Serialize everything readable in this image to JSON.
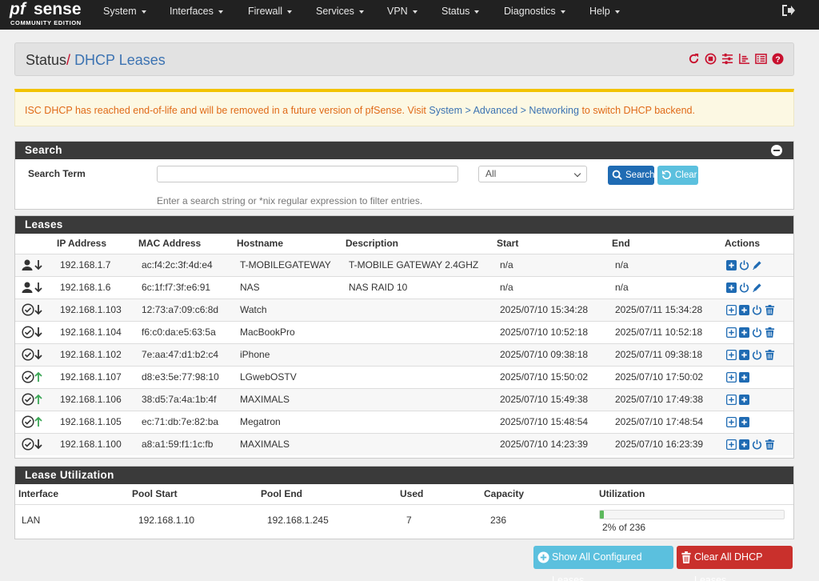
{
  "brand": {
    "logo_text_pf": "pf",
    "logo_text_sense": "sense",
    "edition": "COMMUNITY EDITION"
  },
  "nav": {
    "items": [
      "System",
      "Interfaces",
      "Firewall",
      "Services",
      "VPN",
      "Status",
      "Diagnostics",
      "Help"
    ],
    "logout_icon": "sign-out-icon"
  },
  "header": {
    "section": "Status",
    "separator": "/",
    "page": "DHCP Leases",
    "icons": [
      "reload-icon",
      "stop-circle-icon",
      "sliders-icon",
      "bar-chart-icon",
      "list-icon",
      "help-icon"
    ]
  },
  "alert": {
    "text_before": "ISC DHCP has reached end-of-life and will be removed in a future version of pfSense. Visit ",
    "link": "System > Advanced > Networking",
    "text_after": " to switch DHCP backend."
  },
  "search": {
    "heading": "Search",
    "label": "Search Term",
    "input_value": "",
    "select_value": "All",
    "search_button": "Search",
    "clear_button": "Clear",
    "help": "Enter a search string or *nix regular expression to filter entries."
  },
  "leases": {
    "heading": "Leases",
    "columns": [
      "IP Address",
      "MAC Address",
      "Hostname",
      "Description",
      "Start",
      "End",
      "Actions"
    ],
    "rows": [
      {
        "type": "static",
        "online": false,
        "ip": "192.168.1.7",
        "mac": "ac:f4:2c:3f:4d:e4",
        "host": "T-MOBILEGATEWAY",
        "desc": "T-MOBILE GATEWAY 2.4GHZ",
        "start": "n/a",
        "end": "n/a"
      },
      {
        "type": "static",
        "online": false,
        "ip": "192.168.1.6",
        "mac": "6c:1f:f7:3f:e6:91",
        "host": "NAS",
        "desc": "NAS RAID 10",
        "start": "n/a",
        "end": "n/a"
      },
      {
        "type": "active",
        "online": false,
        "ip": "192.168.1.103",
        "mac": "12:73:a7:09:c6:8d",
        "host": "Watch",
        "desc": "",
        "start": "2025/07/10 15:34:28",
        "end": "2025/07/11 15:34:28"
      },
      {
        "type": "active",
        "online": false,
        "ip": "192.168.1.104",
        "mac": "f6:c0:da:e5:63:5a",
        "host": "MacBookPro",
        "desc": "",
        "start": "2025/07/10 10:52:18",
        "end": "2025/07/11 10:52:18"
      },
      {
        "type": "active",
        "online": false,
        "ip": "192.168.1.102",
        "mac": "7e:aa:47:d1:b2:c4",
        "host": "iPhone",
        "desc": "",
        "start": "2025/07/10 09:38:18",
        "end": "2025/07/11 09:38:18"
      },
      {
        "type": "active",
        "online": true,
        "ip": "192.168.1.107",
        "mac": "d8:e3:5e:77:98:10",
        "host": "LGwebOSTV",
        "desc": "",
        "start": "2025/07/10 15:50:02",
        "end": "2025/07/10 17:50:02"
      },
      {
        "type": "active",
        "online": true,
        "ip": "192.168.1.106",
        "mac": "38:d5:7a:4a:1b:4f",
        "host": "MAXIMALS",
        "desc": "",
        "start": "2025/07/10 15:49:38",
        "end": "2025/07/10 17:49:38"
      },
      {
        "type": "active",
        "online": true,
        "ip": "192.168.1.105",
        "mac": "ec:71:db:7e:82:ba",
        "host": "Megatron",
        "desc": "",
        "start": "2025/07/10 15:48:54",
        "end": "2025/07/10 17:48:54"
      },
      {
        "type": "active",
        "online": false,
        "ip": "192.168.1.100",
        "mac": "a8:a1:59:f1:1c:fb",
        "host": "MAXIMALS",
        "desc": "",
        "start": "2025/07/10 14:23:39",
        "end": "2025/07/10 16:23:39"
      }
    ]
  },
  "utilization": {
    "heading": "Lease Utilization",
    "columns": [
      "Interface",
      "Pool Start",
      "Pool End",
      "Used",
      "Capacity",
      "Utilization"
    ],
    "row": {
      "interface": "LAN",
      "pool_start": "192.168.1.10",
      "pool_end": "192.168.1.245",
      "used": "7",
      "capacity": "236",
      "utilization_text": "2% of 236",
      "utilization_fraction": 0.02
    }
  },
  "buttons": {
    "show_all": "Show All Configured Leases",
    "clear_all": "Clear All DHCP Leases"
  },
  "colors": {
    "navbar": "#212121",
    "link": "#3c73b2",
    "accent_red": "#c8102e",
    "primary": "#1f6bb3",
    "info": "#5bc0de",
    "danger": "#c9302c",
    "online": "#3aa655"
  }
}
